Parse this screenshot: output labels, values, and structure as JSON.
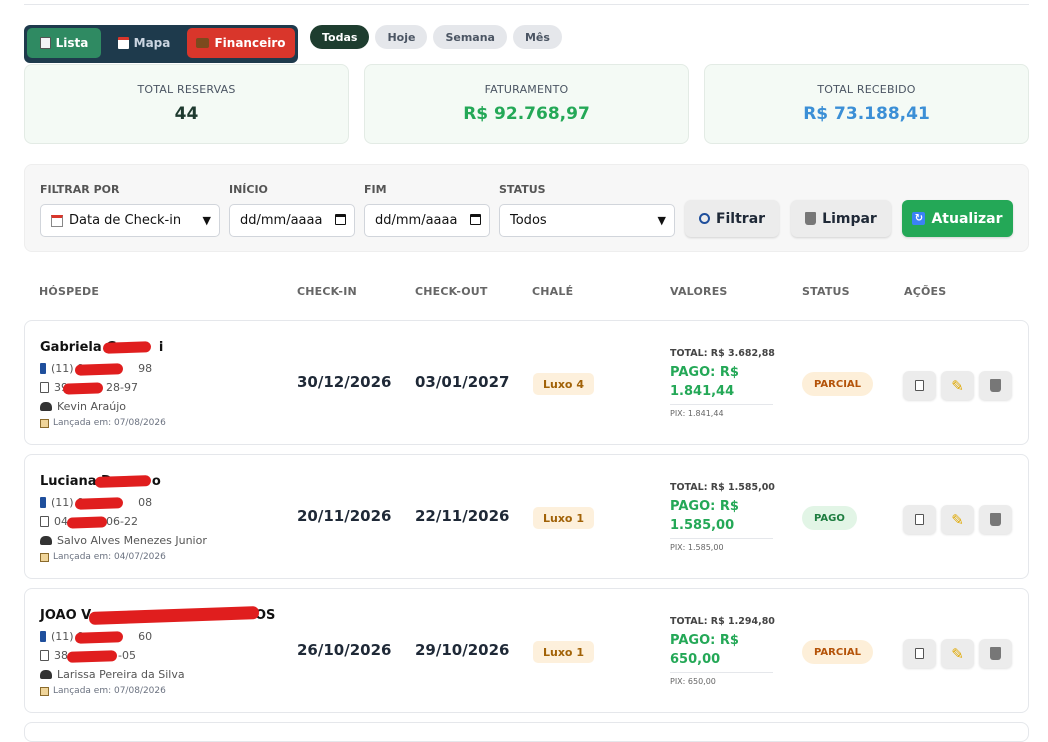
{
  "view_tabs": [
    {
      "label": "Lista",
      "icon": "clipboard-icon"
    },
    {
      "label": "Mapa",
      "icon": "calendar-icon"
    },
    {
      "label": "Financeiro",
      "icon": "briefcase-icon"
    }
  ],
  "period_filters": [
    "Todas",
    "Hoje",
    "Semana",
    "Mês"
  ],
  "stats": {
    "total_reservas": {
      "label": "TOTAL RESERVAS",
      "value": "44"
    },
    "faturamento": {
      "label": "FATURAMENTO",
      "value": "R$ 92.768,97"
    },
    "total_recebido": {
      "label": "TOTAL RECEBIDO",
      "value": "R$ 73.188,41"
    }
  },
  "filters": {
    "filtrar_por": {
      "label": "FILTRAR POR",
      "value": "Data de Check-in"
    },
    "inicio": {
      "label": "INÍCIO",
      "placeholder": "dd/mm/aaaa"
    },
    "fim": {
      "label": "FIM",
      "placeholder": "dd/mm/aaaa"
    },
    "status": {
      "label": "STATUS",
      "value": "Todos"
    },
    "filtrar_button": "Filtrar",
    "limpar_button": "Limpar",
    "atualizar_button": "Atualizar"
  },
  "table": {
    "headers": [
      "HÓSPEDE",
      "CHECK-IN",
      "CHECK-OUT",
      "CHALÉ",
      "VALORES",
      "STATUS",
      "AÇÕES"
    ],
    "rows": [
      {
        "name": "Gabriela G",
        "name_suffix": "i",
        "phone": "(11) 9",
        "phone_suffix": "98",
        "doc": "39",
        "doc_suffix": "28-97",
        "agent": "Kevin Araújo",
        "launched": "Lançada em: 07/08/2026",
        "checkin": "30/12/2026",
        "checkout": "03/01/2027",
        "chale": "Luxo 4",
        "total": "TOTAL: R$ 3.682,88",
        "pago": "PAGO: R$ 1.841,44",
        "pix": "PIX: 1.841,44",
        "status": "PARCIAL"
      },
      {
        "name": "Luciana D",
        "name_suffix": "o",
        "phone": "(11) 9",
        "phone_suffix": "08",
        "doc": "04",
        "doc_suffix": "06-22",
        "agent": "Salvo Alves Menezes Junior",
        "launched": "Lançada em: 04/07/2026",
        "checkin": "20/11/2026",
        "checkout": "22/11/2026",
        "chale": "Luxo 1",
        "total": "TOTAL: R$ 1.585,00",
        "pago": "PAGO: R$ 1.585,00",
        "pix": "PIX: 1.585,00",
        "status": "PAGO"
      },
      {
        "name": "JOAO V",
        "name_suffix": "A SANTOS",
        "phone": "(11) 9",
        "phone_suffix": "60",
        "doc": "38",
        "doc_suffix": "-05",
        "agent": "Larissa Pereira da Silva",
        "launched": "Lançada em: 07/08/2026",
        "checkin": "26/10/2026",
        "checkout": "29/10/2026",
        "chale": "Luxo 1",
        "total": "TOTAL: R$ 1.294,80",
        "pago": "PAGO: R$ 650,00",
        "pix": "PIX: 650,00",
        "status": "PARCIAL"
      }
    ]
  },
  "colors": {
    "faturamento": "#24a857",
    "recebido": "#3b8fd6",
    "total_reservas": "#1e3a2f",
    "lista_tab": "#2f8a62",
    "financeiro_tab": "#d9362b",
    "atualizar": "#24a857"
  }
}
